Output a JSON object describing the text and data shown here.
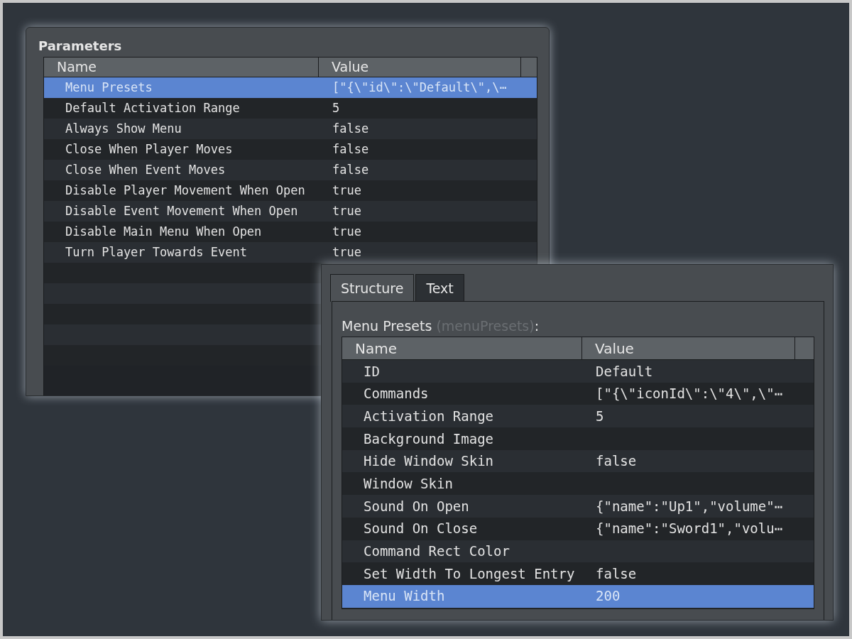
{
  "parameters_window": {
    "title": "Parameters",
    "columns": [
      "Name",
      "Value"
    ],
    "rows": [
      {
        "name": "Menu Presets",
        "value": "[\"{\\\"id\\\":\\\"Default\\\",\\⋯",
        "selected": true
      },
      {
        "name": "Default Activation Range",
        "value": "5",
        "selected": false
      },
      {
        "name": "Always Show Menu",
        "value": "false",
        "selected": false
      },
      {
        "name": "Close When Player Moves",
        "value": "false",
        "selected": false
      },
      {
        "name": "Close When Event Moves",
        "value": "false",
        "selected": false
      },
      {
        "name": "Disable Player Movement When Open",
        "value": "true",
        "selected": false
      },
      {
        "name": "Disable Event Movement When Open",
        "value": "true",
        "selected": false
      },
      {
        "name": "Disable Main Menu When Open",
        "value": "true",
        "selected": false
      },
      {
        "name": "Turn Player Towards Event",
        "value": "true",
        "selected": false
      }
    ]
  },
  "struct_window": {
    "tabs": [
      {
        "label": "Structure",
        "selected": true
      },
      {
        "label": "Text",
        "selected": false
      }
    ],
    "label": "Menu Presets",
    "key_hint": "(menuPresets)",
    "label_suffix": ":",
    "columns": [
      "Name",
      "Value"
    ],
    "rows": [
      {
        "name": "ID",
        "value": "Default",
        "selected": false
      },
      {
        "name": "Commands",
        "value": "[\"{\\\"iconId\\\":\\\"4\\\",\\\"⋯",
        "selected": false
      },
      {
        "name": "Activation Range",
        "value": "5",
        "selected": false
      },
      {
        "name": "Background Image",
        "selected": false
      },
      {
        "name": "Hide Window Skin",
        "value": "false",
        "selected": false
      },
      {
        "name": "Window Skin",
        "selected": false
      },
      {
        "name": "Sound On Open",
        "value": "{\"name\":\"Up1\",\"volume\"⋯",
        "selected": false
      },
      {
        "name": "Sound On Close",
        "value": "{\"name\":\"Sword1\",\"volu⋯",
        "selected": false
      },
      {
        "name": "Command Rect Color",
        "selected": false
      },
      {
        "name": "Set Width To Longest Entry",
        "value": "false",
        "selected": false
      },
      {
        "name": "Menu Width",
        "value": "200",
        "selected": true
      }
    ]
  }
}
